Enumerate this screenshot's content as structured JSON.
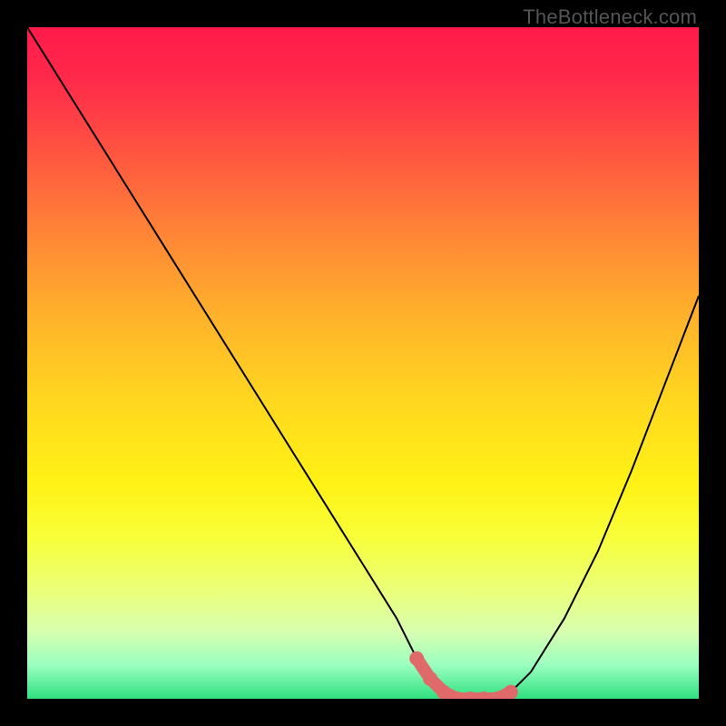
{
  "watermark": "TheBottleneck.com",
  "chart_data": {
    "type": "line",
    "title": "",
    "xlabel": "",
    "ylabel": "",
    "xlim": [
      0,
      100
    ],
    "ylim": [
      0,
      100
    ],
    "series": [
      {
        "name": "bottleneck-curve",
        "x": [
          0,
          5,
          10,
          15,
          20,
          25,
          30,
          35,
          40,
          45,
          50,
          55,
          58,
          60,
          62,
          65,
          68,
          70,
          72,
          75,
          80,
          85,
          90,
          95,
          100
        ],
        "y": [
          100,
          92,
          84,
          76,
          68,
          60,
          52,
          44,
          36,
          28,
          20,
          12,
          6,
          3,
          1,
          0,
          0,
          0,
          1,
          4,
          12,
          22,
          34,
          47,
          60
        ]
      },
      {
        "name": "highlight-points",
        "x": [
          58,
          60,
          62,
          64,
          66,
          68,
          70,
          72
        ],
        "y": [
          6,
          3,
          1,
          0,
          0,
          0,
          0,
          1
        ]
      }
    ]
  },
  "colors": {
    "curve": "#000000",
    "highlight": "#e06a6a",
    "background_top": "#ff1a4a",
    "background_bottom": "#30e080"
  }
}
